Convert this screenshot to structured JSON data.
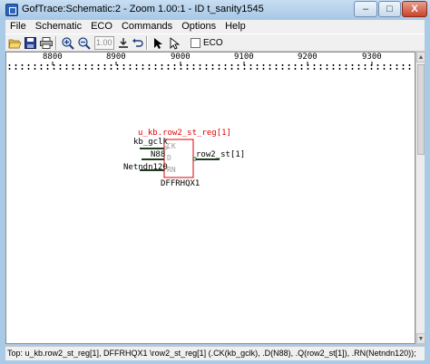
{
  "window": {
    "title": "GofTrace:Schematic:2 - Zoom 1.00:1 - ID t_sanity1545",
    "minimize_glyph": "–",
    "maximize_glyph": "□",
    "close_glyph": "X"
  },
  "menu": [
    "File",
    "Schematic",
    "ECO",
    "Commands",
    "Options",
    "Help"
  ],
  "toolbar": {
    "zoom_value": "1.00",
    "eco_label": "ECO",
    "eco_checked": false,
    "icons": [
      "open-folder-icon",
      "save-icon",
      "print-icon",
      "zoom-in-icon",
      "zoom-out-icon",
      "zoom-value-field",
      "download-arrow-icon",
      "undo-icon",
      "select-cursor-icon",
      "move-cursor-icon"
    ]
  },
  "ruler": {
    "labels": [
      "8800",
      "8900",
      "9000",
      "9100",
      "9200",
      "9300"
    ]
  },
  "schematic": {
    "instance_name": "u_kb.row2_st_reg[1]",
    "cell_type": "DFFRHQX1",
    "pins": {
      "ck": "CK",
      "d": "D",
      "rn": "RN",
      "q": "Q"
    },
    "nets": {
      "ck": "kb_gclk",
      "d": "N88",
      "rn": "Netndn120",
      "q": "row2_st[1]"
    },
    "colors": {
      "instance": "#e00000",
      "wire": "#1f3d1f",
      "pin_text": "#9a9a9a"
    }
  },
  "status": {
    "text": "Top: u_kb.row2_st_reg[1], DFFRHQX1 \\row2_st_reg[1] (.CK(kb_gclk), .D(N88), .Q(row2_st[1]), .RN(Netndn120));"
  }
}
